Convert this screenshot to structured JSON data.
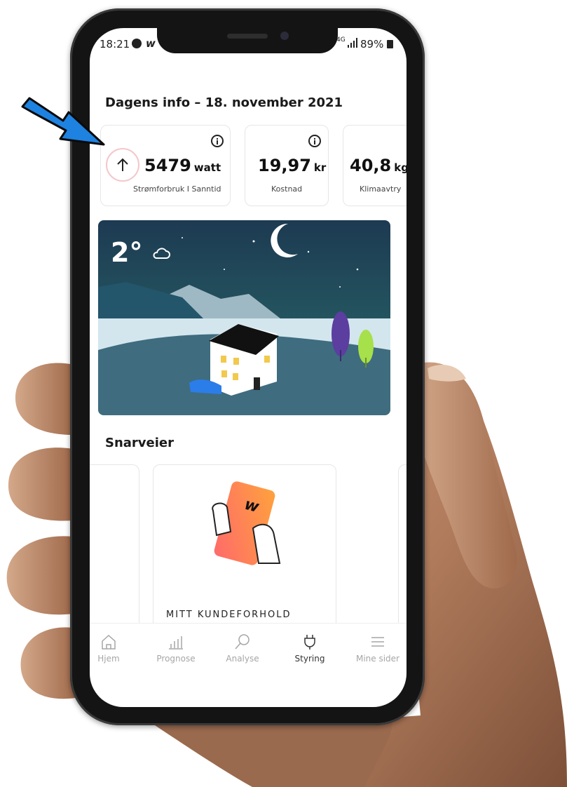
{
  "status_bar": {
    "time": "18:21",
    "network": "4G",
    "battery": "89%"
  },
  "dagens_info": {
    "title": "Dagens info – 18. november 2021",
    "cards": [
      {
        "value": "5479",
        "unit": "watt",
        "label": "Strømforbruk I Sanntid"
      },
      {
        "value": "19,97",
        "unit": "kr",
        "label": "Kostnad"
      },
      {
        "value": "40,8",
        "unit": "kg",
        "label": "Klimaavtry"
      }
    ]
  },
  "weather": {
    "temperature": "2°"
  },
  "snarveier": {
    "title": "Snarveier",
    "card_label": "MITT KUNDEFORHOLD",
    "logo_letter": "w"
  },
  "tabbar": {
    "tabs": [
      {
        "label": "Hjem",
        "icon": "home-icon"
      },
      {
        "label": "Prognose",
        "icon": "bar-chart-icon"
      },
      {
        "label": "Analyse",
        "icon": "magnifier-icon"
      },
      {
        "label": "Styring",
        "icon": "plug-icon",
        "active": true
      },
      {
        "label": "Mine sider",
        "icon": "menu-icon"
      }
    ]
  },
  "colors": {
    "arrow": "#1e82e0",
    "night_sky": "#1f3d55",
    "tree_purple": "#5b3ea0",
    "tree_green": "#a6e04a",
    "card_gradient_start": "#ff6a6a",
    "card_gradient_end": "#ff9e3d"
  }
}
